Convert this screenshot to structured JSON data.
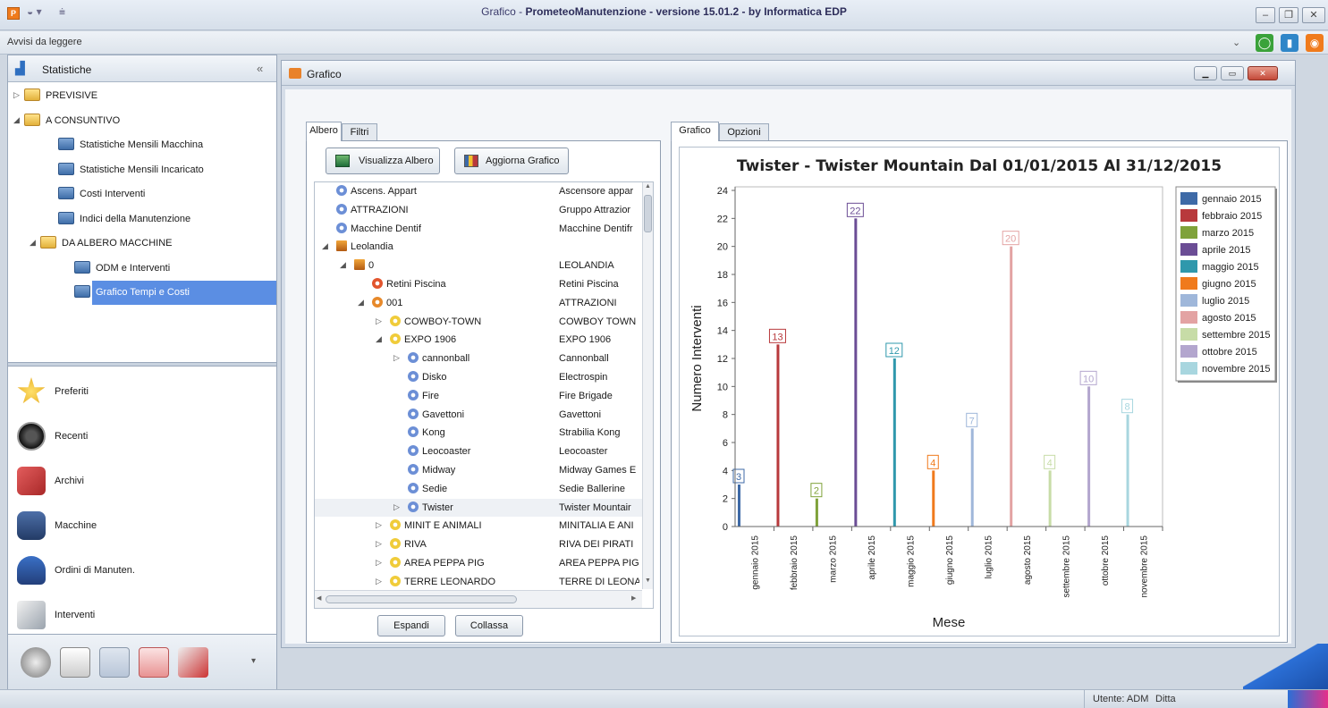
{
  "window": {
    "app_letter": "P",
    "title_prefix": "Grafico - ",
    "title_main": "PrometeoManutenzione - versione 15.01.2 - by Informatica EDP",
    "notice": "Avvisi da leggere"
  },
  "nav": {
    "header": "Statistiche",
    "items": [
      {
        "label": "PREVISIVE",
        "type": "folder",
        "level": 0,
        "expand": "collapsed"
      },
      {
        "label": "A CONSUNTIVO",
        "type": "folder",
        "level": 0,
        "expand": "expanded"
      },
      {
        "label": "Statistiche Mensili Macchina",
        "type": "report",
        "level": 1
      },
      {
        "label": "Statistiche Mensili Incaricato",
        "type": "report",
        "level": 1
      },
      {
        "label": "Costi Interventi",
        "type": "report",
        "level": 1
      },
      {
        "label": "Indici della Manutenzione",
        "type": "report",
        "level": 1
      },
      {
        "label": "DA ALBERO MACCHINE",
        "type": "folder",
        "level": 1,
        "expand": "expanded"
      },
      {
        "label": "ODM e Interventi",
        "type": "report",
        "level": 2
      },
      {
        "label": "Grafico Tempi e Costi",
        "type": "report",
        "level": 2,
        "selected": true
      }
    ],
    "sections": [
      "Preferiti",
      "Recenti",
      "Archivi",
      "Macchine",
      "Ordini di Manuten.",
      "Interventi"
    ]
  },
  "child_window": {
    "title": "Grafico",
    "left_tabs": [
      "Albero",
      "Filtri"
    ],
    "right_tabs": [
      "Grafico",
      "Opzioni"
    ],
    "btn_visualizza": "Visualizza Albero",
    "btn_aggiorna": "Aggiorna Grafico",
    "btn_espandi": "Espandi",
    "btn_collassa": "Collassa",
    "tree_rows": [
      {
        "name": "Ascens. Appart",
        "desc": "Ascensore appar",
        "indent": 0,
        "expand": "",
        "icon": "gear"
      },
      {
        "name": "ATTRAZIONI",
        "desc": "Gruppo Attrazior",
        "indent": 0,
        "expand": "",
        "icon": "gear"
      },
      {
        "name": "Macchine Dentif",
        "desc": "Macchine Dentifr",
        "indent": 0,
        "expand": "",
        "icon": "gear"
      },
      {
        "name": "Leolandia",
        "desc": "",
        "indent": 0,
        "expand": "expanded",
        "icon": "factory"
      },
      {
        "name": "0",
        "desc": "LEOLANDIA",
        "indent": 1,
        "expand": "expanded",
        "icon": "factory"
      },
      {
        "name": "Retini Piscina",
        "desc": "Retini Piscina",
        "indent": 2,
        "expand": "",
        "icon": "red"
      },
      {
        "name": "001",
        "desc": "ATTRAZIONI",
        "indent": 2,
        "expand": "expanded",
        "icon": "orange"
      },
      {
        "name": "COWBOY-TOWN",
        "desc": "COWBOY TOWN",
        "indent": 3,
        "expand": "collapsed",
        "icon": "yellow"
      },
      {
        "name": "EXPO 1906",
        "desc": "EXPO 1906",
        "indent": 3,
        "expand": "expanded",
        "icon": "yellow"
      },
      {
        "name": "cannonball",
        "desc": "Cannonball",
        "indent": 4,
        "expand": "collapsed",
        "icon": "gear"
      },
      {
        "name": "Disko",
        "desc": "Electrospin",
        "indent": 4,
        "expand": "",
        "icon": "gear"
      },
      {
        "name": "Fire",
        "desc": "Fire Brigade",
        "indent": 4,
        "expand": "",
        "icon": "gear"
      },
      {
        "name": "Gavettoni",
        "desc": "Gavettoni",
        "indent": 4,
        "expand": "",
        "icon": "gear"
      },
      {
        "name": "Kong",
        "desc": "Strabilia Kong",
        "indent": 4,
        "expand": "",
        "icon": "gear"
      },
      {
        "name": "Leocoaster",
        "desc": "Leocoaster",
        "indent": 4,
        "expand": "",
        "icon": "gear"
      },
      {
        "name": "Midway",
        "desc": "Midway Games E",
        "indent": 4,
        "expand": "",
        "icon": "gear"
      },
      {
        "name": "Sedie",
        "desc": "Sedie Ballerine",
        "indent": 4,
        "expand": "",
        "icon": "gear"
      },
      {
        "name": "Twister",
        "desc": "Twister Mountair",
        "indent": 4,
        "expand": "collapsed",
        "icon": "gear",
        "selected": true
      },
      {
        "name": "MINIT E ANIMALI",
        "desc": "MINITALIA E ANI",
        "indent": 3,
        "expand": "collapsed",
        "icon": "yellow"
      },
      {
        "name": "RIVA",
        "desc": "RIVA DEI PIRATI",
        "indent": 3,
        "expand": "collapsed",
        "icon": "yellow"
      },
      {
        "name": "AREA PEPPA PIG",
        "desc": "AREA PEPPA PIG",
        "indent": 3,
        "expand": "collapsed",
        "icon": "yellow"
      },
      {
        "name": "TERRE LEONARDO",
        "desc": "TERRE DI LEONA",
        "indent": 3,
        "expand": "collapsed",
        "icon": "yellow"
      }
    ]
  },
  "status": {
    "user": "Utente: ADM",
    "company": "Ditta"
  },
  "chart_data": {
    "type": "bar",
    "title": "Twister - Twister Mountain Dal 01/01/2015 Al 31/12/2015",
    "xlabel": "Mese",
    "ylabel": "Numero Interventi",
    "ylim": [
      0,
      24
    ],
    "yticks": [
      0,
      2,
      4,
      6,
      8,
      10,
      12,
      14,
      16,
      18,
      20,
      22,
      24
    ],
    "grid": false,
    "legend_position": "top-right",
    "categories": [
      "gennaio 2015",
      "febbraio 2015",
      "marzo 2015",
      "aprile 2015",
      "maggio 2015",
      "giugno 2015",
      "luglio 2015",
      "agosto 2015",
      "settembre 2015",
      "ottobre 2015",
      "novembre 2015"
    ],
    "series": [
      {
        "name": "gennaio 2015",
        "values": [
          3
        ],
        "color": "#3e6aa7"
      },
      {
        "name": "febbraio 2015",
        "values": [
          13
        ],
        "color": "#b8393c"
      },
      {
        "name": "marzo 2015",
        "values": [
          2
        ],
        "color": "#7fa23a"
      },
      {
        "name": "aprile 2015",
        "values": [
          22
        ],
        "color": "#6b4d95"
      },
      {
        "name": "maggio 2015",
        "values": [
          12
        ],
        "color": "#2f98ac"
      },
      {
        "name": "giugno 2015",
        "values": [
          4
        ],
        "color": "#f07a1c"
      },
      {
        "name": "luglio 2015",
        "values": [
          7
        ],
        "color": "#9fb7da"
      },
      {
        "name": "agosto 2015",
        "values": [
          20
        ],
        "color": "#e3a3a3"
      },
      {
        "name": "settembre 2015",
        "values": [
          4
        ],
        "color": "#c7dca7"
      },
      {
        "name": "ottobre 2015",
        "values": [
          10
        ],
        "color": "#b3a6ce"
      },
      {
        "name": "novembre 2015",
        "values": [
          8
        ],
        "color": "#a8d6df"
      }
    ]
  }
}
